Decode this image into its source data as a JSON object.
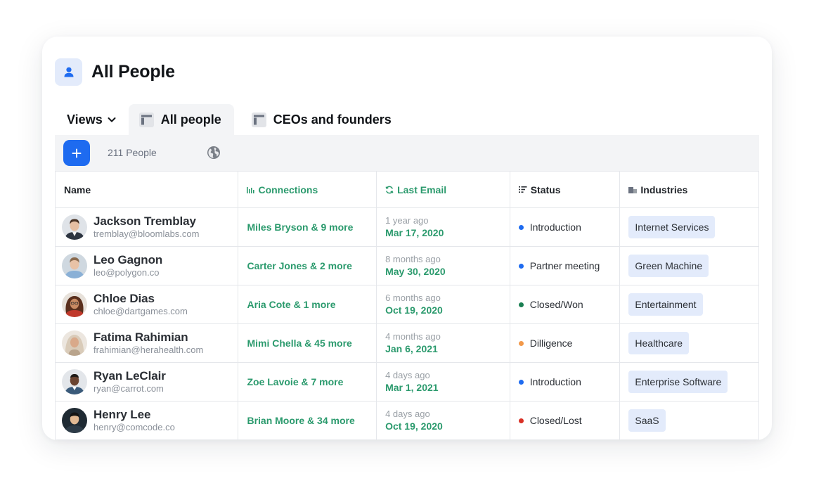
{
  "page": {
    "title": "All People"
  },
  "views": {
    "label": "Views",
    "tabs": [
      {
        "label": "All people",
        "active": true
      },
      {
        "label": "CEOs and founders",
        "active": false
      }
    ]
  },
  "toolbar": {
    "count_label": "211 People"
  },
  "table": {
    "columns": {
      "name": "Name",
      "connections": "Connections",
      "last_email": "Last Email",
      "status": "Status",
      "industries": "Industries"
    },
    "rows": [
      {
        "name": "Jackson Tremblay",
        "email": "tremblay@bloomlabs.com",
        "connections": "Miles Bryson & 9 more",
        "ago": "1 year ago",
        "date": "Mar 17, 2020",
        "status": "Introduction",
        "status_color": "#1e6bf0",
        "industry": "Internet Services"
      },
      {
        "name": "Leo Gagnon",
        "email": "leo@polygon.co",
        "connections": "Carter Jones & 2 more",
        "ago": "8 months ago",
        "date": "May 30, 2020",
        "status": "Partner meeting",
        "status_color": "#1e6bf0",
        "industry": "Green Machine"
      },
      {
        "name": "Chloe Dias",
        "email": "chloe@dartgames.com",
        "connections": "Aria Cote & 1 more",
        "ago": "6 months ago",
        "date": "Oct 19, 2020",
        "status": "Closed/Won",
        "status_color": "#1a7f52",
        "industry": "Entertainment"
      },
      {
        "name": "Fatima Rahimian",
        "email": "frahimian@herahealth.com",
        "connections": "Mimi Chella & 45 more",
        "ago": "4 months ago",
        "date": "Jan 6, 2021",
        "status": "Dilligence",
        "status_color": "#f2994a",
        "industry": "Healthcare"
      },
      {
        "name": "Ryan LeClair",
        "email": "ryan@carrot.com",
        "connections": "Zoe Lavoie & 7 more",
        "ago": "4 days ago",
        "date": "Mar 1, 2021",
        "status": "Introduction",
        "status_color": "#1e6bf0",
        "industry": "Enterprise Software"
      },
      {
        "name": "Henry Lee",
        "email": "henry@comcode.co",
        "connections": "Brian Moore & 34 more",
        "ago": "4 days ago",
        "date": "Oct 19, 2020",
        "status": "Closed/Lost",
        "status_color": "#d93025",
        "industry": "SaaS"
      }
    ]
  },
  "colors": {
    "accent_blue": "#1e6bf0",
    "accent_green": "#2b9a6d",
    "badge_bg": "#e3ebfb",
    "toolbar_bg": "#f3f4f6"
  },
  "icons": {
    "header": "person-icon",
    "views_dropdown": "chevron-down-icon",
    "tab": "table-view-icon",
    "add": "plus-icon",
    "visibility": "globe-icon",
    "connections": "bar-chart-icon",
    "last_email": "refresh-icon",
    "status": "list-sort-icon",
    "industries": "building-icon"
  }
}
